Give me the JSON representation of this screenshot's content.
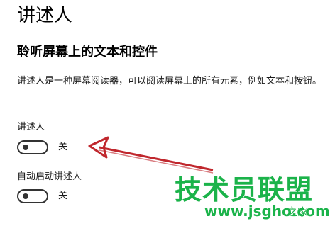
{
  "page": {
    "title": "讲述人",
    "subtitle": "聆听屏幕上的文本和控件",
    "description": "讲述人是一种屏幕阅读器，可以阅读屏幕上的所有元素，例如文本和按钮。"
  },
  "settings": [
    {
      "label": "讲述人",
      "state": "关",
      "on": false
    },
    {
      "label": "自动启动讲述人",
      "state": "关",
      "on": false
    }
  ],
  "watermark": {
    "main": "技术员联盟",
    "url": "www.jsgho.com",
    "home": "之家"
  },
  "colors": {
    "text": "#000000",
    "toggle_off": "#333333",
    "annotation_arrow": "#c0272d",
    "watermark": "#1bb34a"
  }
}
